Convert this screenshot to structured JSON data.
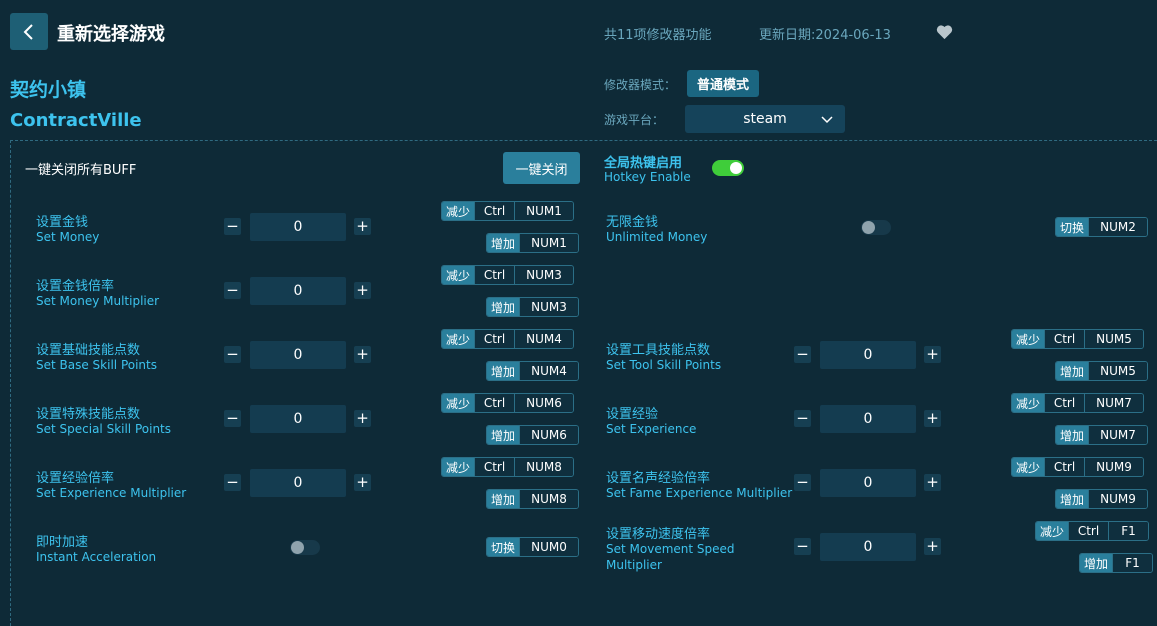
{
  "header": {
    "title": "重新选择游戏",
    "feature_count": "共11项修改器功能",
    "update_date": "更新日期:2024-06-13"
  },
  "game": {
    "name_cn": "契约小镇",
    "name_en": "ContractVille"
  },
  "mode": {
    "label": "修改器模式：",
    "value": "普通模式"
  },
  "platform": {
    "label": "游戏平台：",
    "value": "steam"
  },
  "global": {
    "close_all_label": "一键关闭所有BUFF",
    "close_all_button": "一键关闭",
    "hotkey_cn": "全局热键启用",
    "hotkey_en": "Hotkey Enable"
  },
  "labels": {
    "decrease": "减少",
    "increase": "增加",
    "toggle": "切换",
    "ctrl": "Ctrl"
  },
  "cheats": {
    "set_money": {
      "cn": "设置金钱",
      "en": "Set Money",
      "value": "0",
      "dec_key": "NUM1",
      "inc_key": "NUM1"
    },
    "unlimited_money": {
      "cn": "无限金钱",
      "en": "Unlimited Money",
      "toggle_key": "NUM2"
    },
    "money_multiplier": {
      "cn": "设置金钱倍率",
      "en": "Set Money Multiplier",
      "value": "0",
      "dec_key": "NUM3",
      "inc_key": "NUM3"
    },
    "base_skill": {
      "cn": "设置基础技能点数",
      "en": "Set Base Skill Points",
      "value": "0",
      "dec_key": "NUM4",
      "inc_key": "NUM4"
    },
    "tool_skill": {
      "cn": "设置工具技能点数",
      "en": "Set Tool Skill Points",
      "value": "0",
      "dec_key": "NUM5",
      "inc_key": "NUM5"
    },
    "special_skill": {
      "cn": "设置特殊技能点数",
      "en": "Set Special Skill Points",
      "value": "0",
      "dec_key": "NUM6",
      "inc_key": "NUM6"
    },
    "experience": {
      "cn": "设置经验",
      "en": "Set Experience",
      "value": "0",
      "dec_key": "NUM7",
      "inc_key": "NUM7"
    },
    "exp_multiplier": {
      "cn": "设置经验倍率",
      "en": "Set Experience Multiplier",
      "value": "0",
      "dec_key": "NUM8",
      "inc_key": "NUM8"
    },
    "fame_exp_multiplier": {
      "cn": "设置名声经验倍率",
      "en": "Set Fame Experience Multiplier",
      "value": "0",
      "dec_key": "NUM9",
      "inc_key": "NUM9"
    },
    "instant_accel": {
      "cn": "即时加速",
      "en": "Instant Acceleration",
      "toggle_key": "NUM0"
    },
    "move_speed": {
      "cn": "设置移动速度倍率",
      "en_line1": "Set Movement Speed",
      "en_line2": "Multiplier",
      "value": "0",
      "dec_key": "F1",
      "inc_key": "F1"
    }
  },
  "icons": {
    "back": "back-arrow-icon",
    "favorite": "heart-icon",
    "dropdown": "chevron-down-icon"
  }
}
